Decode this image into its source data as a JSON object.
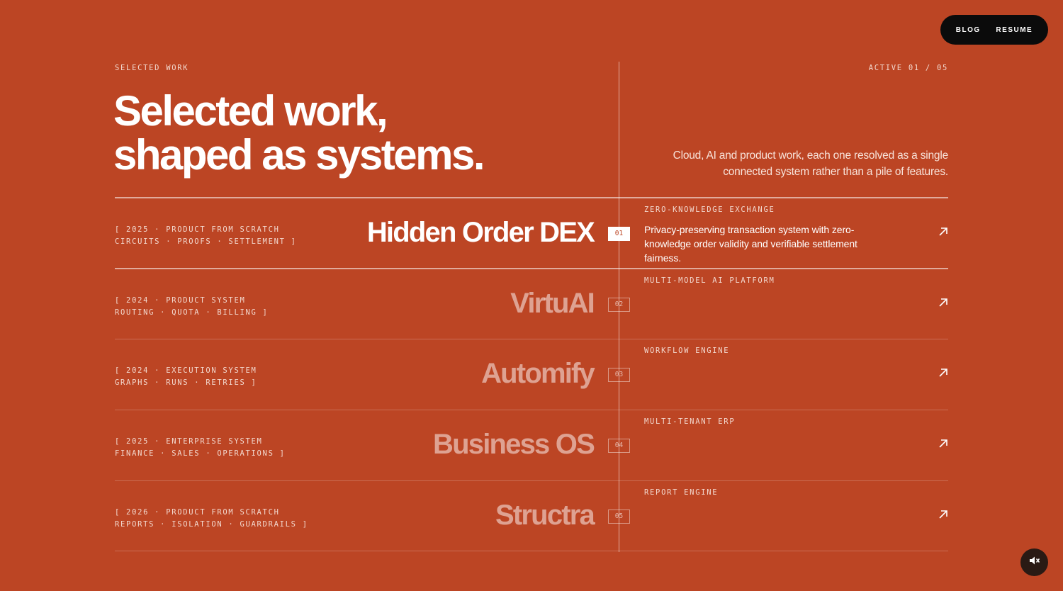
{
  "nav": {
    "blog": "BLOG",
    "resume": "RESUME"
  },
  "header": {
    "eyebrow": "SELECTED WORK",
    "active_indicator": "ACTIVE 01 / 05",
    "headline_line1": "Selected work,",
    "headline_line2": "shaped as systems.",
    "intro": "Cloud, AI and product work, each one resolved as a single connected system rather than a pile of features."
  },
  "projects": [
    {
      "meta_line1": "[ 2025 · PRODUCT FROM SCRATCH",
      "meta_line2": "CIRCUITS · PROOFS · SETTLEMENT ]",
      "title": "Hidden Order DEX",
      "number": "01",
      "category": "ZERO-KNOWLEDGE EXCHANGE",
      "description": "Privacy-preserving transaction system with zero-knowledge order validity and verifiable settlement fairness.",
      "active": true
    },
    {
      "meta_line1": "[ 2024 · PRODUCT SYSTEM",
      "meta_line2": "ROUTING · QUOTA · BILLING ]",
      "title": "VirtuAI",
      "number": "02",
      "category": "MULTI-MODEL AI PLATFORM",
      "description": "",
      "active": false
    },
    {
      "meta_line1": "[ 2024 · EXECUTION SYSTEM",
      "meta_line2": "GRAPHS · RUNS · RETRIES ]",
      "title": "Automify",
      "number": "03",
      "category": "WORKFLOW ENGINE",
      "description": "",
      "active": false
    },
    {
      "meta_line1": "[ 2025 · ENTERPRISE SYSTEM",
      "meta_line2": "FINANCE · SALES · OPERATIONS ]",
      "title": "Business OS",
      "number": "04",
      "category": "MULTI-TENANT ERP",
      "description": "",
      "active": false
    },
    {
      "meta_line1": "[ 2026 · PRODUCT FROM SCRATCH",
      "meta_line2": "REPORTS · ISOLATION · GUARDRAILS ]",
      "title": "Structra",
      "number": "05",
      "category": "REPORT ENGINE",
      "description": "",
      "active": false
    }
  ],
  "icons": {
    "row_link": "arrow-up-right-icon",
    "sound": "speaker-muted-icon"
  },
  "colors": {
    "background": "#BC4524",
    "nav_pill": "#0b0b0b",
    "text": "#ffffff"
  }
}
